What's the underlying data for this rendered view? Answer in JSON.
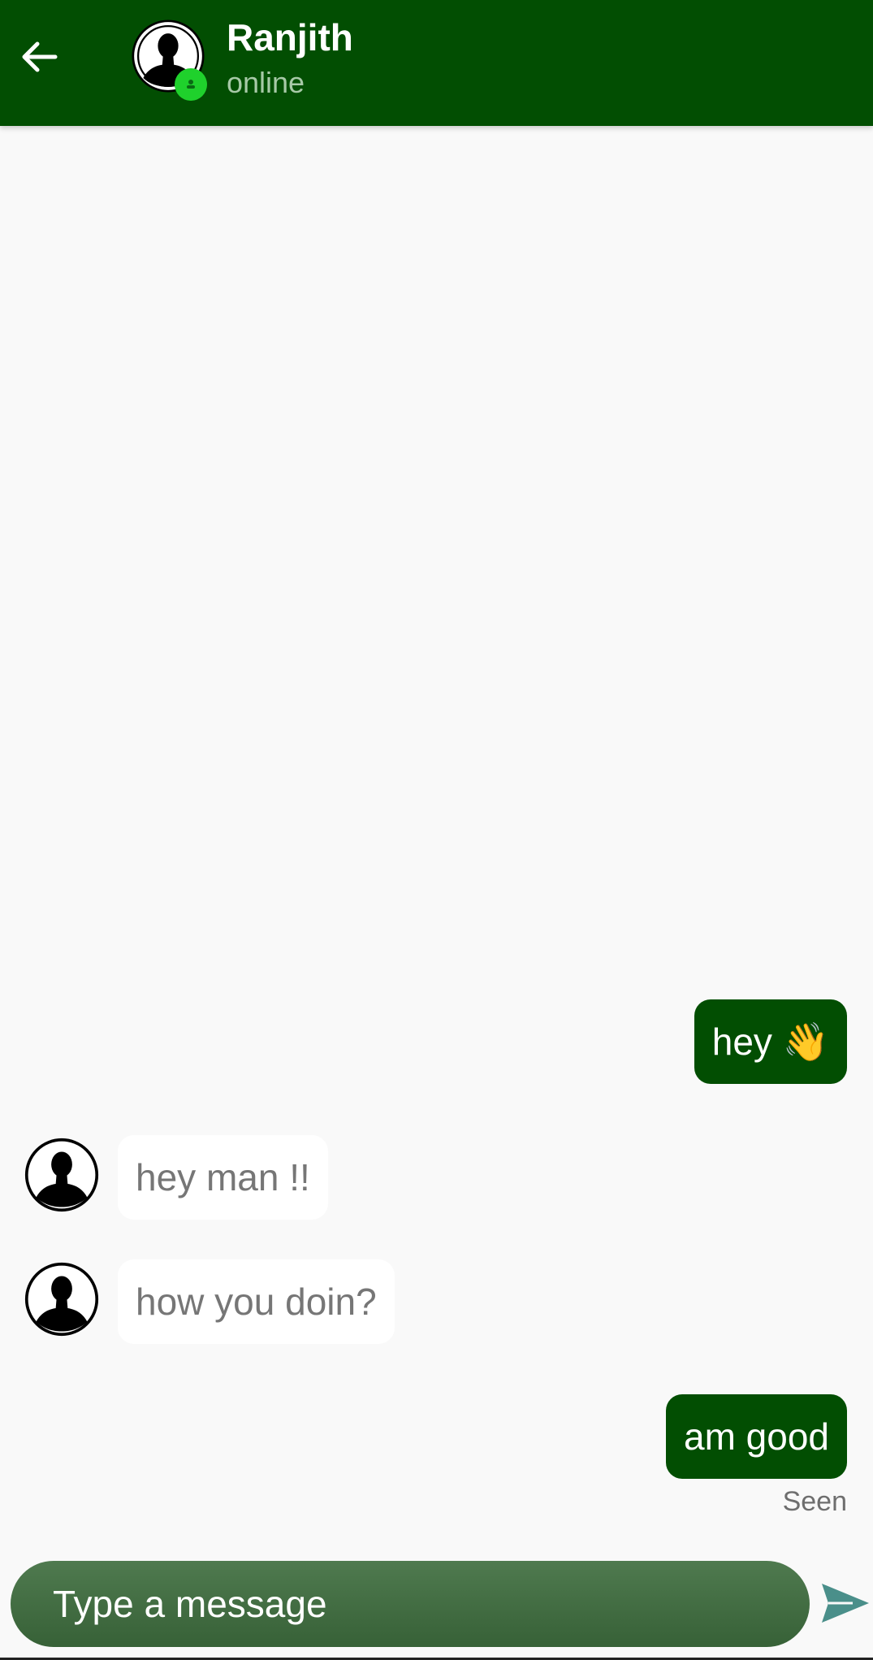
{
  "header": {
    "name": "Ranjith",
    "status": "online",
    "colors": {
      "bar": "#024e02",
      "status_text": "#a7c9a7",
      "online_dot": "#1fd12c"
    }
  },
  "icons": {
    "back": "arrow-left-icon",
    "avatar": "person-silhouette-icon",
    "online": "online-dot-icon",
    "send": "send-icon"
  },
  "messages": [
    {
      "direction": "outgoing",
      "text": "hey 👋"
    },
    {
      "direction": "incoming",
      "text": "hey man !!"
    },
    {
      "direction": "incoming",
      "text": "how you doin?"
    },
    {
      "direction": "outgoing",
      "text": "am good"
    }
  ],
  "seen_label": "Seen",
  "composer": {
    "placeholder": "Type a message"
  },
  "colors": {
    "outgoing_bubble": "#024e02",
    "incoming_bubble": "#ffffff",
    "incoming_text": "#767676",
    "background": "#f9f9f9",
    "send_icon": "#4a8f8a"
  }
}
